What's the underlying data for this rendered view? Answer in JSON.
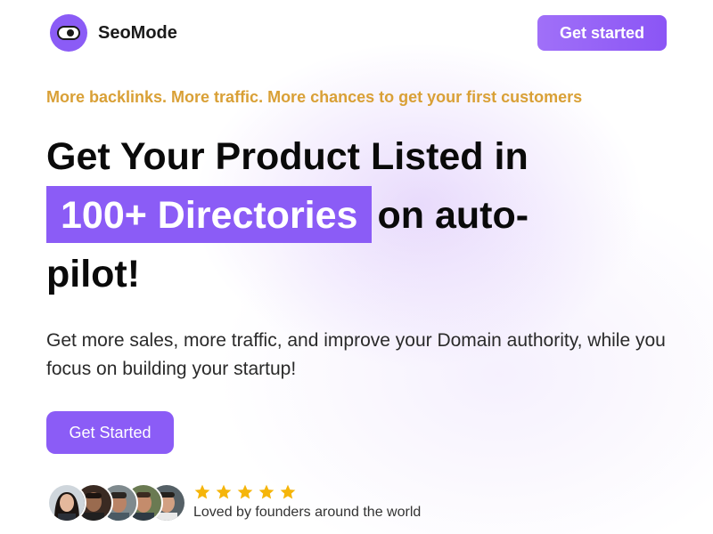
{
  "brand": {
    "name": "SeoMode",
    "logo_icon": "toggle-icon",
    "accent_color": "#8b5cf6"
  },
  "header": {
    "cta_label": "Get started"
  },
  "hero": {
    "tagline": "More backlinks. More traffic. More chances to get your first customers",
    "tagline_color": "#d9a036",
    "headline_line1": "Get Your Product Listed in",
    "headline_highlight": "100+ Directories",
    "headline_after_highlight": "on auto-",
    "headline_line3": "pilot!",
    "subheadline": "Get more sales, more traffic, and improve your Domain authority, while you focus on building your startup!",
    "cta_label": "Get Started"
  },
  "social_proof": {
    "avatar_count": 5,
    "rating": 5,
    "star_icon": "star-icon",
    "star_color": "#f5b50a",
    "text": "Loved by founders around the world"
  }
}
